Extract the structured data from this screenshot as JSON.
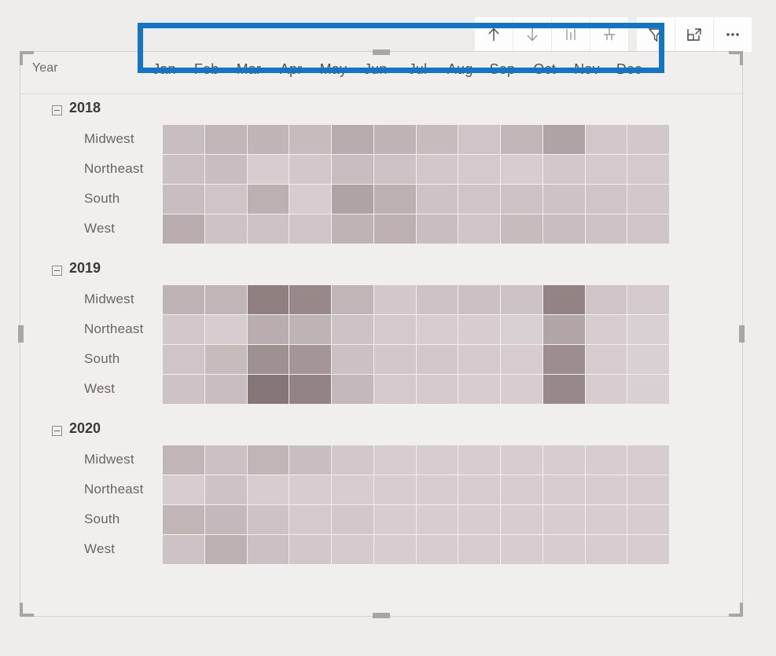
{
  "toolbar": {
    "buttons": [
      {
        "name": "drill-up-icon",
        "tooltip": "Drill Up"
      },
      {
        "name": "drill-down-icon",
        "tooltip": "Drill Down"
      },
      {
        "name": "expand-all-icon",
        "tooltip": "Expand all down one level in the hierarchy"
      },
      {
        "name": "drill-mode-icon",
        "tooltip": "Go to the next level in the hierarchy"
      },
      {
        "name": "filter-icon",
        "tooltip": "Filters"
      },
      {
        "name": "focus-mode-icon",
        "tooltip": "Focus mode"
      },
      {
        "name": "more-options-icon",
        "tooltip": "More options"
      }
    ]
  },
  "highlight": {
    "color": "#1275c6",
    "target": "column-headers"
  },
  "matrix": {
    "row_header_label": "Year",
    "column_headers": [
      "Jan",
      "Feb",
      "Mar",
      "Apr",
      "May",
      "Jun",
      "Jul",
      "Aug",
      "Sep",
      "Oct",
      "Nov",
      "Dec"
    ],
    "row_groups": [
      {
        "label": "2018",
        "expanded": true,
        "rows": [
          "Midwest",
          "Northeast",
          "South",
          "West"
        ]
      },
      {
        "label": "2019",
        "expanded": true,
        "rows": [
          "Midwest",
          "Northeast",
          "South",
          "West"
        ]
      },
      {
        "label": "2020",
        "expanded": true,
        "rows": [
          "Midwest",
          "Northeast",
          "South",
          "West"
        ]
      }
    ]
  },
  "chart_data": {
    "type": "heatmap",
    "title": "",
    "xlabel": "",
    "ylabel": "Year",
    "x": [
      "Jan",
      "Feb",
      "Mar",
      "Apr",
      "May",
      "Jun",
      "Jul",
      "Aug",
      "Sep",
      "Oct",
      "Nov",
      "Dec"
    ],
    "y": [
      "2018 Midwest",
      "2018 Northeast",
      "2018 South",
      "2018 West",
      "2019 Midwest",
      "2019 Northeast",
      "2019 South",
      "2019 West",
      "2020 Midwest",
      "2020 Northeast",
      "2020 South",
      "2020 West"
    ],
    "colorscale": {
      "min": "#ded5d8",
      "max": "#7d6b6d"
    },
    "legend": "none",
    "grid": true,
    "note": "values are relative intensities 0-100 read from cell shading; blank = no data",
    "values": [
      [
        38,
        44,
        45,
        40,
        52,
        46,
        40,
        32,
        44,
        58,
        30,
        30
      ],
      [
        36,
        38,
        26,
        30,
        38,
        34,
        30,
        28,
        26,
        30,
        28,
        28
      ],
      [
        38,
        32,
        48,
        26,
        58,
        48,
        34,
        32,
        34,
        34,
        32,
        30
      ],
      [
        50,
        34,
        34,
        32,
        46,
        48,
        38,
        32,
        40,
        38,
        34,
        32
      ],
      [
        46,
        44,
        84,
        78,
        44,
        30,
        34,
        36,
        34,
        82,
        32,
        28
      ],
      [
        30,
        26,
        50,
        46,
        34,
        28,
        26,
        26,
        24,
        56,
        26,
        24
      ],
      [
        32,
        40,
        72,
        68,
        36,
        30,
        30,
        28,
        26,
        74,
        26,
        24
      ],
      [
        34,
        38,
        92,
        82,
        42,
        28,
        28,
        26,
        26,
        78,
        26,
        24
      ],
      [
        44,
        36,
        44,
        38,
        30,
        26,
        26,
        26,
        26,
        26,
        26,
        26
      ],
      [
        26,
        34,
        26,
        26,
        26,
        26,
        26,
        26,
        26,
        26,
        26,
        26
      ],
      [
        44,
        42,
        34,
        28,
        30,
        26,
        26,
        26,
        26,
        26,
        26,
        26
      ],
      [
        34,
        48,
        36,
        30,
        28,
        26,
        26,
        26,
        26,
        26,
        26,
        26
      ]
    ]
  }
}
